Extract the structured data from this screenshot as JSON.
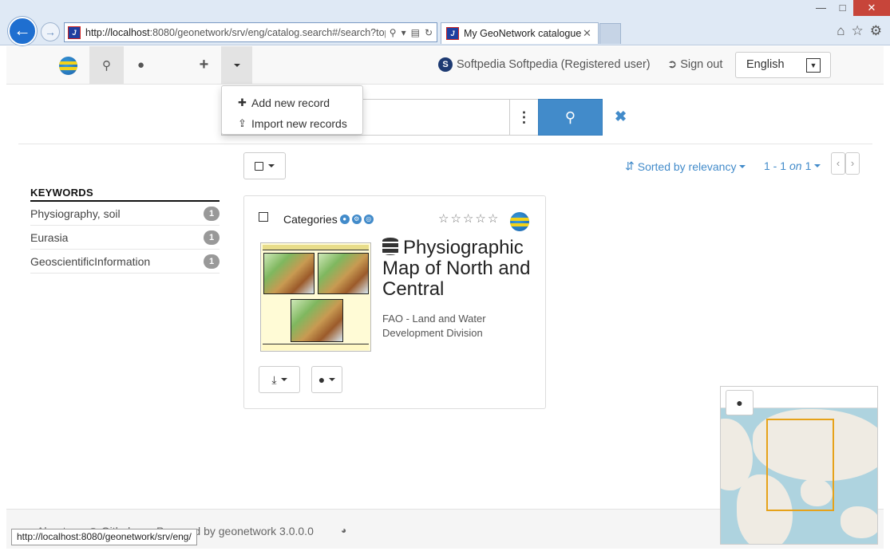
{
  "browser": {
    "url_host": "http://localhost",
    "url_rest": ":8080/geonetwork/srv/eng/catalog.search#/search?top",
    "tab_title": "My GeoNetwork catalogue ...",
    "favicon_text": "J"
  },
  "navbar": {
    "user_name": "Softpedia Softpedia (Registered user)",
    "user_initial": "S",
    "sign_out": "Sign out",
    "language": "English"
  },
  "dropdown": {
    "items": [
      {
        "label": "Add new record"
      },
      {
        "label": "Import new records"
      }
    ]
  },
  "toolbar": {
    "sort_label": "Sorted by relevancy",
    "pager_prefix": "1 - 1",
    "pager_on": "on",
    "pager_total": "1"
  },
  "facets": {
    "title": "KEYWORDS",
    "items": [
      {
        "label": "Physiography, soil",
        "count": "1"
      },
      {
        "label": "Eurasia",
        "count": "1"
      },
      {
        "label": "GeoscientificInformation",
        "count": "1"
      }
    ]
  },
  "record": {
    "categories_label": "Categories",
    "title": "Physiographic Map of North and Central",
    "organisation": "FAO - Land and Water Development Division",
    "rating": 0,
    "rating_max": 5
  },
  "footer": {
    "about": "About",
    "github": "Github",
    "powered_by": "Powered by geonetwork 3.0.0.0"
  },
  "status_bar": {
    "url": "http://localhost:8080/geonetwork/srv/eng/"
  },
  "colors": {
    "primary": "#428bca",
    "bbox": "#e6a21a"
  }
}
